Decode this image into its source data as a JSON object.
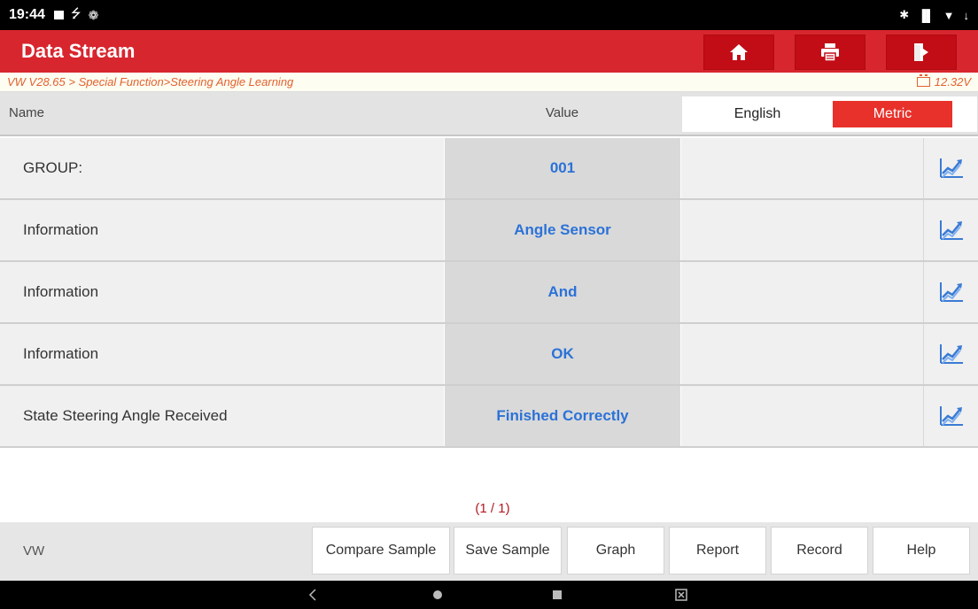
{
  "status_bar": {
    "time": "19:44",
    "right_text": "✱ •◆• ▼ ↓"
  },
  "header": {
    "title": "Data Stream"
  },
  "breadcrumb": {
    "path": "VW V28.65 > Special Function>Steering Angle Learning",
    "voltage": "12.32V"
  },
  "columns": {
    "name": "Name",
    "value": "Value",
    "unit_english": "English",
    "unit_metric": "Metric",
    "selected_unit": "Metric"
  },
  "rows": [
    {
      "name": "GROUP:",
      "value": "001",
      "unit": ""
    },
    {
      "name": "Information",
      "value": "Angle Sensor",
      "unit": ""
    },
    {
      "name": "Information",
      "value": "And",
      "unit": ""
    },
    {
      "name": "Information",
      "value": "OK",
      "unit": ""
    },
    {
      "name": "State Steering Angle Received",
      "value": "Finished Correctly",
      "unit": ""
    }
  ],
  "pager": {
    "label": "(1 / 1)"
  },
  "toolbar": {
    "brand": "VW",
    "buttons": [
      "Compare Sample",
      "Save Sample",
      "Graph",
      "Report",
      "Record",
      "Help"
    ]
  },
  "colors": {
    "header_red": "#d8262e",
    "metric_red": "#e8312a",
    "value_blue": "#2b72d8",
    "breadcrumb_orange": "#e3612e",
    "pager_red": "#b31a22"
  },
  "icons": [
    "home-icon",
    "print-icon",
    "exit-icon",
    "battery-icon",
    "graph-icon",
    "back-icon",
    "home-circle-icon",
    "recents-icon",
    "screenshot-icon"
  ]
}
